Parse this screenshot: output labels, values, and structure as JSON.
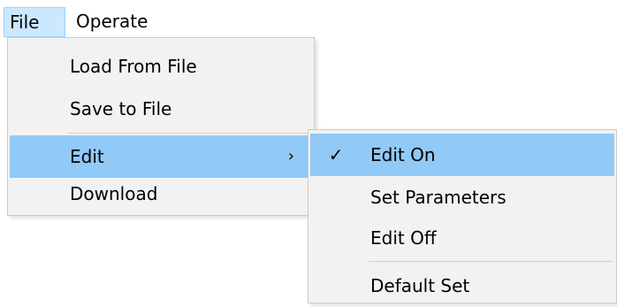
{
  "menubar": {
    "file_label": "File",
    "operate_label": "Operate"
  },
  "file_menu": {
    "items": [
      {
        "label": "Load From File"
      },
      {
        "label": "Save to File"
      },
      {
        "label": "Edit",
        "submenu_arrow": "›"
      },
      {
        "label": "Download"
      }
    ]
  },
  "edit_submenu": {
    "check_glyph": "✓",
    "items": [
      {
        "label": "Edit On",
        "checked": true
      },
      {
        "label": "Set Parameters"
      },
      {
        "label": "Edit Off"
      },
      {
        "label": "Default Set"
      }
    ]
  },
  "colors": {
    "highlight": "#91c9f7",
    "menubar_active": "#cce8ff",
    "menu_background": "#f2f2f2"
  }
}
